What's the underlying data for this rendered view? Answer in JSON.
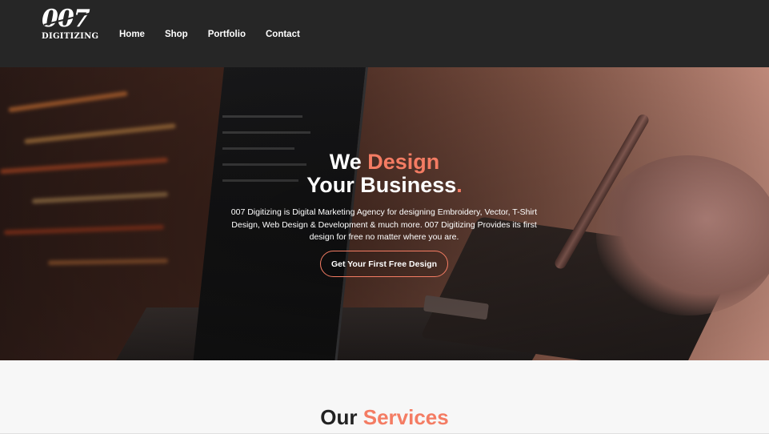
{
  "brand": {
    "logo_number": "007",
    "logo_word": "DIGITIZING"
  },
  "nav": {
    "items": [
      "Home",
      "Shop",
      "Portfolio",
      "Contact"
    ]
  },
  "hero": {
    "title_line1_part1": "We ",
    "title_line1_accent": "Design",
    "title_line2": "Your Business",
    "title_line2_dot": ".",
    "description": "007 Digitizing is Digital Marketing Agency for designing Embroidery, Vector, T-Shirt Design, Web Design & Development & much more. 007 Digitizing Provides its first design for free no matter where you are.",
    "cta_label": "Get Your First Free Design"
  },
  "services": {
    "title_part1": "Our ",
    "title_accent": "Services"
  },
  "colors": {
    "accent": "#f47c63",
    "navbar": "#262626",
    "page_bg": "#f7f7f7"
  }
}
